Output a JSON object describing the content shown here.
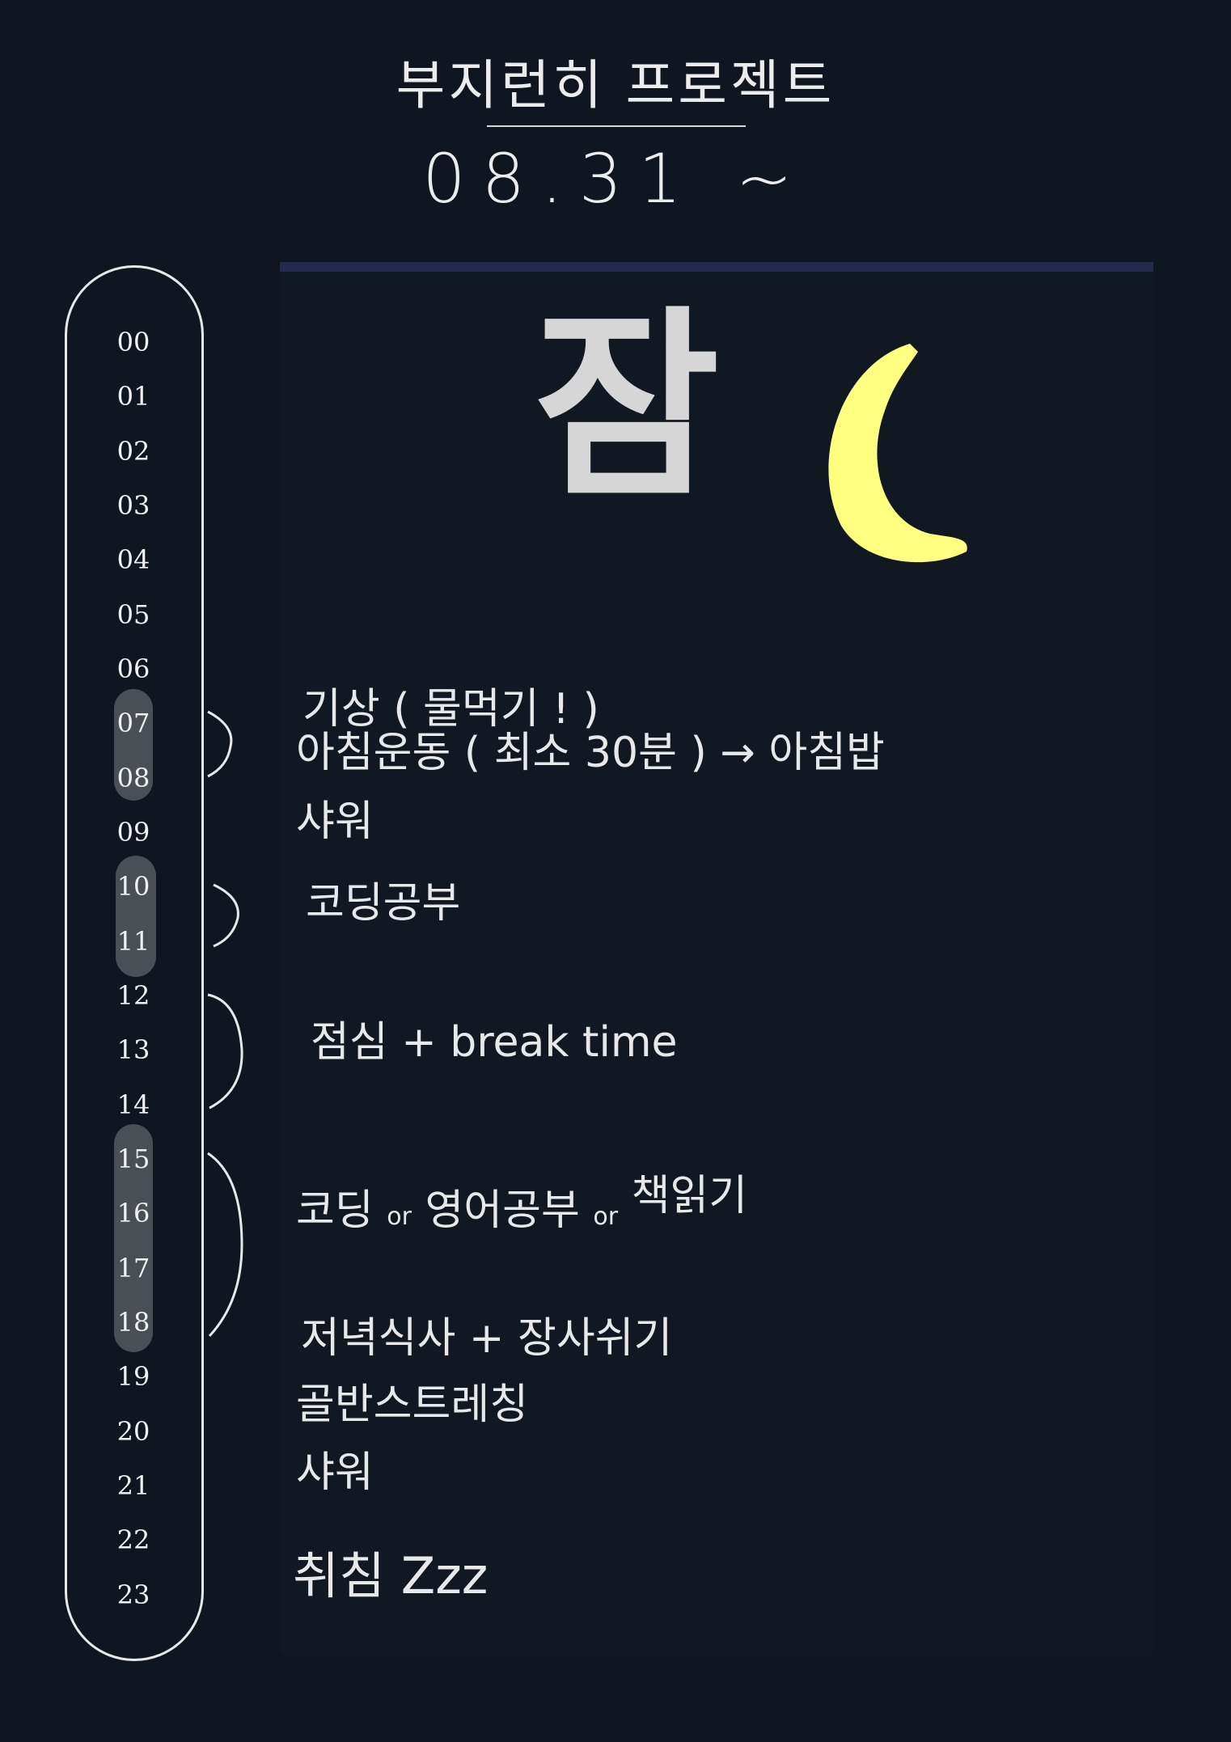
{
  "header": {
    "title": "부지런히 프로젝트",
    "date": "08.31 ~"
  },
  "timeline": {
    "hours": [
      "00",
      "01",
      "02",
      "03",
      "04",
      "05",
      "06",
      "07",
      "08",
      "09",
      "10",
      "11",
      "12",
      "13",
      "14",
      "15",
      "16",
      "17",
      "18",
      "19",
      "20",
      "21",
      "22",
      "23"
    ],
    "highlighted_hours": [
      "07",
      "08",
      "10",
      "11",
      "15",
      "16",
      "17",
      "18"
    ]
  },
  "card": {
    "heading": "잠",
    "moon_color": "#ffff80",
    "accent_color": "#222b4d"
  },
  "schedule": {
    "wake": "기상 ( 물먹기 ! )",
    "exercise": "아침운동 ( 최소 30분 ) → 아침밥",
    "shower1": "샤워",
    "coding": "코딩공부",
    "lunch": "점심 + break time",
    "afternoon_a": "코딩",
    "or1": "or",
    "afternoon_b": "영어공부",
    "or2": "or",
    "afternoon_c": "책읽기",
    "dinner": "저녁식사 + 장사쉬기",
    "stretch": "골반스트레칭",
    "shower2": "샤워",
    "bedtime": "취침 Zzz"
  }
}
